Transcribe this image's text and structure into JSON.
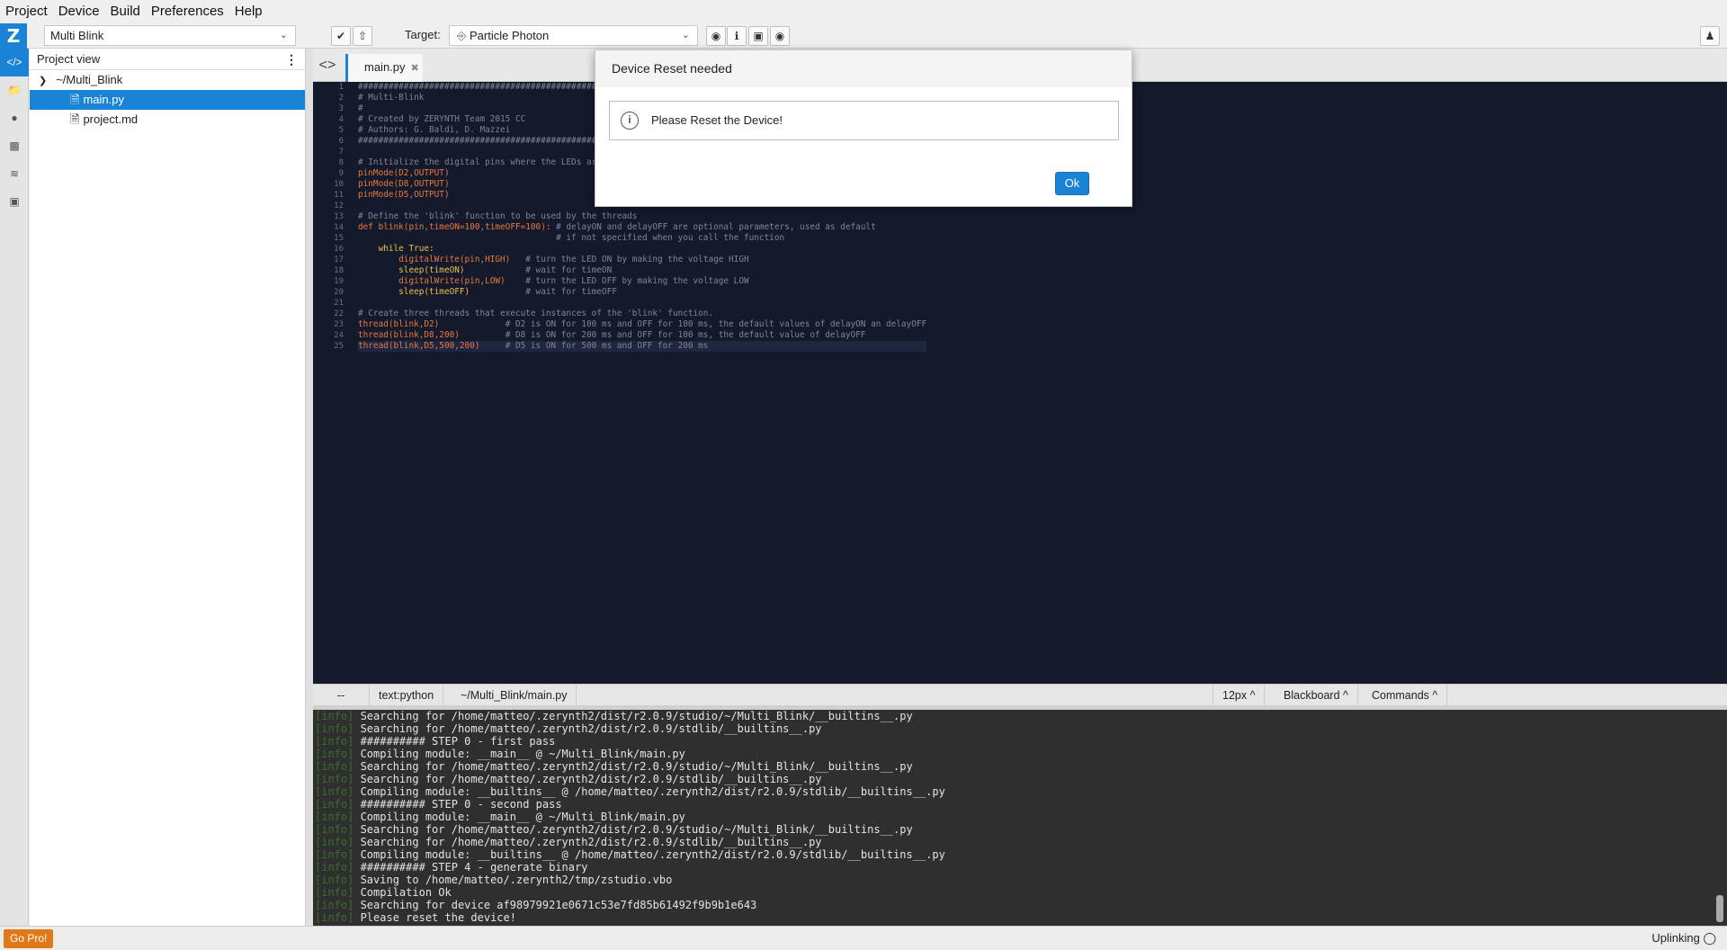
{
  "menu": [
    "Project",
    "Device",
    "Build",
    "Preferences",
    "Help"
  ],
  "toolbar": {
    "logo": "Z",
    "project": "Multi Blink",
    "target_label": "Target:",
    "target": "Particle Photon"
  },
  "project_panel": {
    "title": "Project view",
    "folder": "~/Multi_Blink",
    "files": [
      "main.py",
      "project.md"
    ]
  },
  "editor": {
    "tab": "main.py",
    "lines": [
      "####################################################",
      "# Multi-Blink",
      "#",
      "# Created by ZERYNTH Team 2015 CC",
      "# Authors: G. Baldi, D. Mazzei",
      "####################################################",
      "",
      "# Initialize the digital pins where the LEDs are connected as output",
      "pinMode(D2,OUTPUT)",
      "pinMode(D8,OUTPUT)",
      "pinMode(D5,OUTPUT)",
      "",
      "# Define the 'blink' function to be used by the threads",
      "def blink(pin,timeON=100,timeOFF=100): # delayON and delayOFF are optional parameters, used as default",
      "                                       # if not specified when you call the function",
      "    while True:",
      "        digitalWrite(pin,HIGH)   # turn the LED ON by making the voltage HIGH",
      "        sleep(timeON)            # wait for timeON",
      "        digitalWrite(pin,LOW)    # turn the LED OFF by making the voltage LOW",
      "        sleep(timeOFF)           # wait for timeOFF",
      "",
      "# Create three threads that execute instances of the 'blink' function.",
      "thread(blink,D2)             # D2 is ON for 100 ms and OFF for 100 ms, the default values of delayON an delayOFF",
      "thread(blink,D8,200)         # D8 is ON for 200 ms and OFF for 100 ms, the default value of delayOFF",
      "thread(blink,D5,500,200)     # D5 is ON for 500 ms and OFF for 200 ms"
    ]
  },
  "status": {
    "pos": "--",
    "mode": "text:python",
    "path": "~/Multi_Blink/main.py",
    "font": "12px ^",
    "theme": "Blackboard ^",
    "commands": "Commands ^"
  },
  "console": [
    "Searching for /home/matteo/.zerynth2/dist/r2.0.9/studio/~/Multi_Blink/__builtins__.py",
    "Searching for /home/matteo/.zerynth2/dist/r2.0.9/stdlib/__builtins__.py",
    "########## STEP 0 - first pass",
    "Compiling module: __main__ @ ~/Multi_Blink/main.py",
    "Searching for /home/matteo/.zerynth2/dist/r2.0.9/studio/~/Multi_Blink/__builtins__.py",
    "Searching for /home/matteo/.zerynth2/dist/r2.0.9/stdlib/__builtins__.py",
    "Compiling module: __builtins__ @ /home/matteo/.zerynth2/dist/r2.0.9/stdlib/__builtins__.py",
    "########## STEP 0 - second pass",
    "Compiling module: __main__ @ ~/Multi_Blink/main.py",
    "Searching for /home/matteo/.zerynth2/dist/r2.0.9/studio/~/Multi_Blink/__builtins__.py",
    "Searching for /home/matteo/.zerynth2/dist/r2.0.9/stdlib/__builtins__.py",
    "Compiling module: __builtins__ @ /home/matteo/.zerynth2/dist/r2.0.9/stdlib/__builtins__.py",
    "########## STEP 4 - generate binary",
    "Saving to /home/matteo/.zerynth2/tmp/zstudio.vbo",
    "Compilation Ok",
    "Searching for device af98979921e0671c53e7fd85b61492f9b9b1e643",
    "Please reset the device!"
  ],
  "console_tag": "[info]",
  "bottom": {
    "gopro": "Go Pro!",
    "uplink": "Uplinking"
  },
  "modal": {
    "title": "Device Reset needed",
    "message": "Please Reset the Device!",
    "ok": "Ok"
  }
}
